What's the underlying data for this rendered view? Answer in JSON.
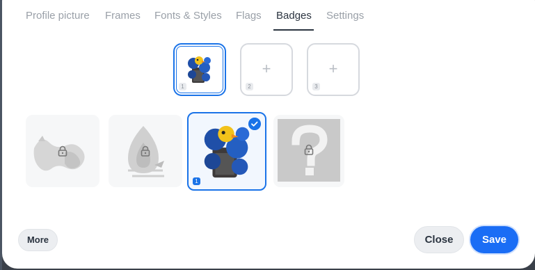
{
  "tabs": [
    {
      "label": "Profile picture",
      "active": false
    },
    {
      "label": "Frames",
      "active": false
    },
    {
      "label": "Fonts & Styles",
      "active": false
    },
    {
      "label": "Flags",
      "active": false
    },
    {
      "label": "Badges",
      "active": true
    },
    {
      "label": "Settings",
      "active": false
    }
  ],
  "slots": [
    {
      "number": "1",
      "filled": true,
      "content_icon": "blue-flower-duck-badge-icon"
    },
    {
      "number": "2",
      "filled": false,
      "content_icon": "plus-icon",
      "plus": "+"
    },
    {
      "number": "3",
      "filled": false,
      "content_icon": "plus-icon",
      "plus": "+"
    }
  ],
  "badges": [
    {
      "icon": "dragon-badge-icon",
      "locked": true,
      "selected": false
    },
    {
      "icon": "flame-badge-icon",
      "locked": true,
      "selected": false
    },
    {
      "icon": "blue-flower-duck-badge-icon",
      "locked": false,
      "selected": true,
      "slot_number": "1"
    },
    {
      "icon": "question-mark-badge-icon",
      "locked": true,
      "selected": false
    }
  ],
  "footer": {
    "more_label": "More",
    "close_label": "Close",
    "save_label": "Save"
  },
  "colors": {
    "accent": "#1a73e8",
    "save_button": "#1a6df5",
    "active_tab": "#2b3440",
    "inactive_tab": "#9aa0a8"
  }
}
